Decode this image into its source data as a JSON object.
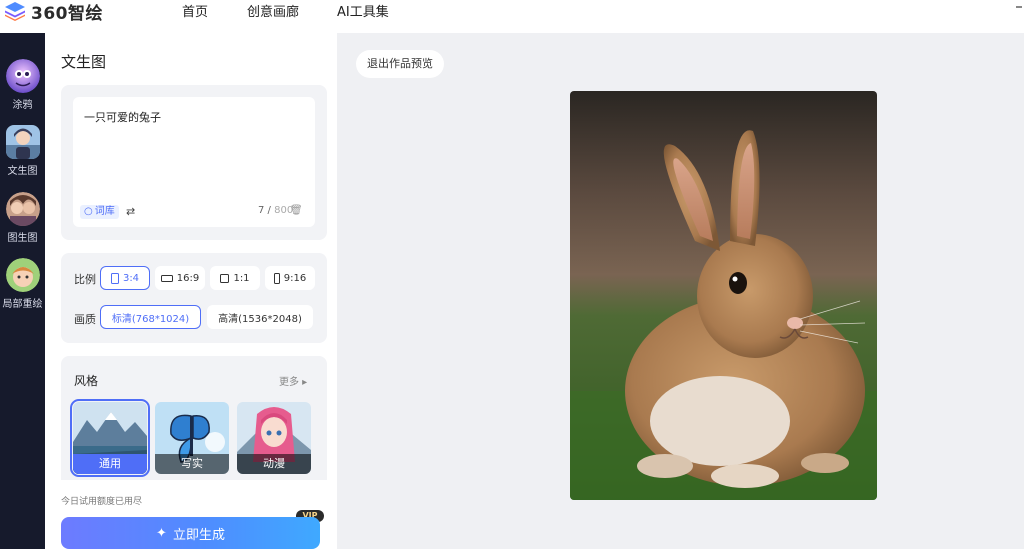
{
  "app": {
    "logo_text": "360智绘",
    "nav": [
      "首页",
      "创意画廊",
      "AI工具集"
    ]
  },
  "rail": [
    {
      "label": "涂鸦",
      "icon": "avatar-graffiti-icon"
    },
    {
      "label": "文生图",
      "icon": "avatar-text-to-image-icon"
    },
    {
      "label": "图生图",
      "icon": "avatar-image-to-image-icon"
    },
    {
      "label": "局部重绘",
      "icon": "avatar-inpaint-icon"
    }
  ],
  "panel": {
    "title": "文生图",
    "prompt": {
      "value": "一只可爱的兔子",
      "library_label": "词库",
      "count": "7",
      "max": "800"
    },
    "ratio": {
      "label": "比例",
      "options": [
        "3:4",
        "16:9",
        "1:1",
        "9:16"
      ],
      "selected": "3:4"
    },
    "quality": {
      "label": "画质",
      "options": [
        "标清(768*1024)",
        "高清(1536*2048)"
      ],
      "selected": "标清(768*1024)"
    },
    "style": {
      "title": "风格",
      "more_label": "更多",
      "options": [
        "通用",
        "写实",
        "动漫"
      ],
      "selected": "通用"
    },
    "quota_text": "今日试用额度已用尽",
    "vip_label": "VIP",
    "generate_label": "立即生成"
  },
  "preview": {
    "exit_label": "退出作品预览"
  },
  "colors": {
    "accent": "#4f6ef7",
    "rail_bg": "#161a2c",
    "preview_bg": "#eff0f3"
  }
}
